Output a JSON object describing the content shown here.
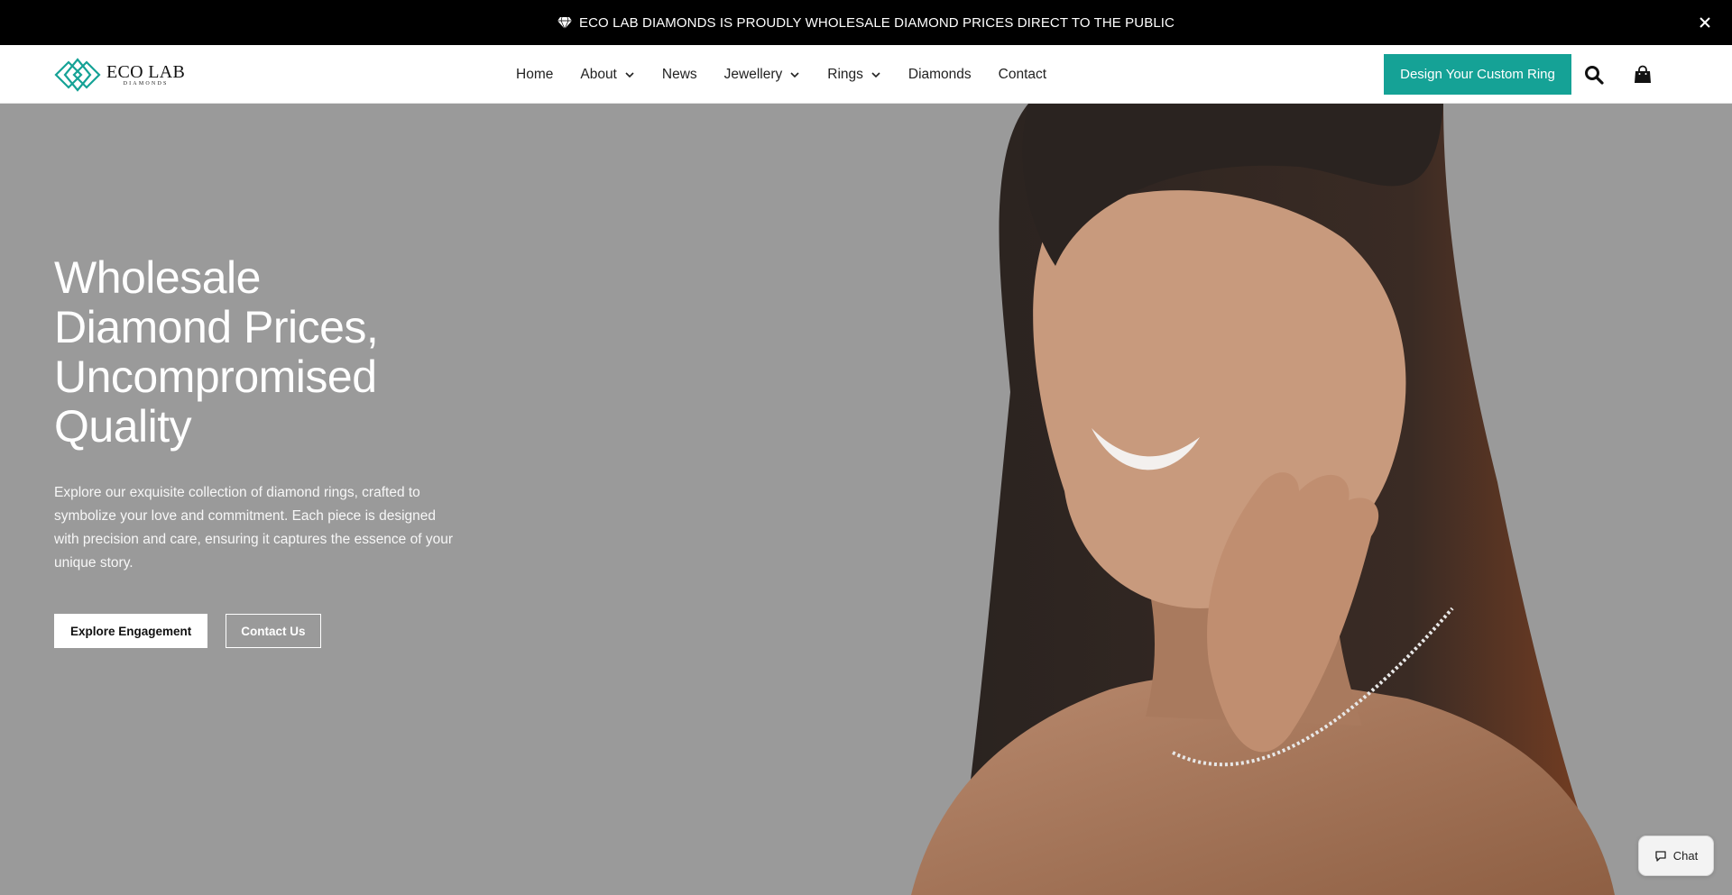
{
  "announcement": {
    "text": "ECO LAB DIAMONDS IS PROUDLY WHOLESALE DIAMOND PRICES DIRECT TO THE PUBLIC",
    "icon": "diamond-icon"
  },
  "header": {
    "logo": {
      "brand": "ECO LAB",
      "sub": "DIAMONDS"
    },
    "nav": [
      {
        "label": "Home",
        "dropdown": false
      },
      {
        "label": "About",
        "dropdown": true
      },
      {
        "label": "News",
        "dropdown": false
      },
      {
        "label": "Jewellery",
        "dropdown": true
      },
      {
        "label": "Rings",
        "dropdown": true
      },
      {
        "label": "Diamonds",
        "dropdown": false
      },
      {
        "label": "Contact",
        "dropdown": false
      }
    ],
    "cta_label": "Design Your Custom Ring",
    "icons": [
      "search-icon",
      "shopping-bag-icon"
    ]
  },
  "hero": {
    "title_lines": [
      "Wholesale",
      "Diamond Prices,",
      "Uncompromised",
      "Quality"
    ],
    "description": "Explore our exquisite collection of diamond rings, crafted to symbolize your love and commitment. Each piece is designed with precision and care, ensuring it captures the essence of your unique story.",
    "primary_button": "Explore Engagement",
    "secondary_button": "Contact Us"
  },
  "chat": {
    "label": "Chat"
  },
  "colors": {
    "accent": "#15a296",
    "announcement_bg": "#000000",
    "hero_overlay": "#9a9a9a"
  }
}
